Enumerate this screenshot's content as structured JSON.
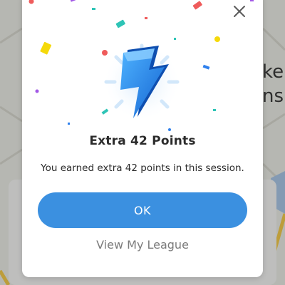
{
  "background": {
    "line1": "ke",
    "line2": "ns"
  },
  "dialog": {
    "close_icon": "close-icon",
    "hero_icon": "lightning-bolt-icon",
    "title": "Extra 42 Points",
    "message": "You earned extra 42 points in this session.",
    "ok_label": "OK",
    "league_link": "View My League",
    "colors": {
      "primary": "#3b90e0",
      "bolt": "#1e6fd9",
      "text": "#2b2b2b",
      "link": "#7b7b7b"
    }
  }
}
